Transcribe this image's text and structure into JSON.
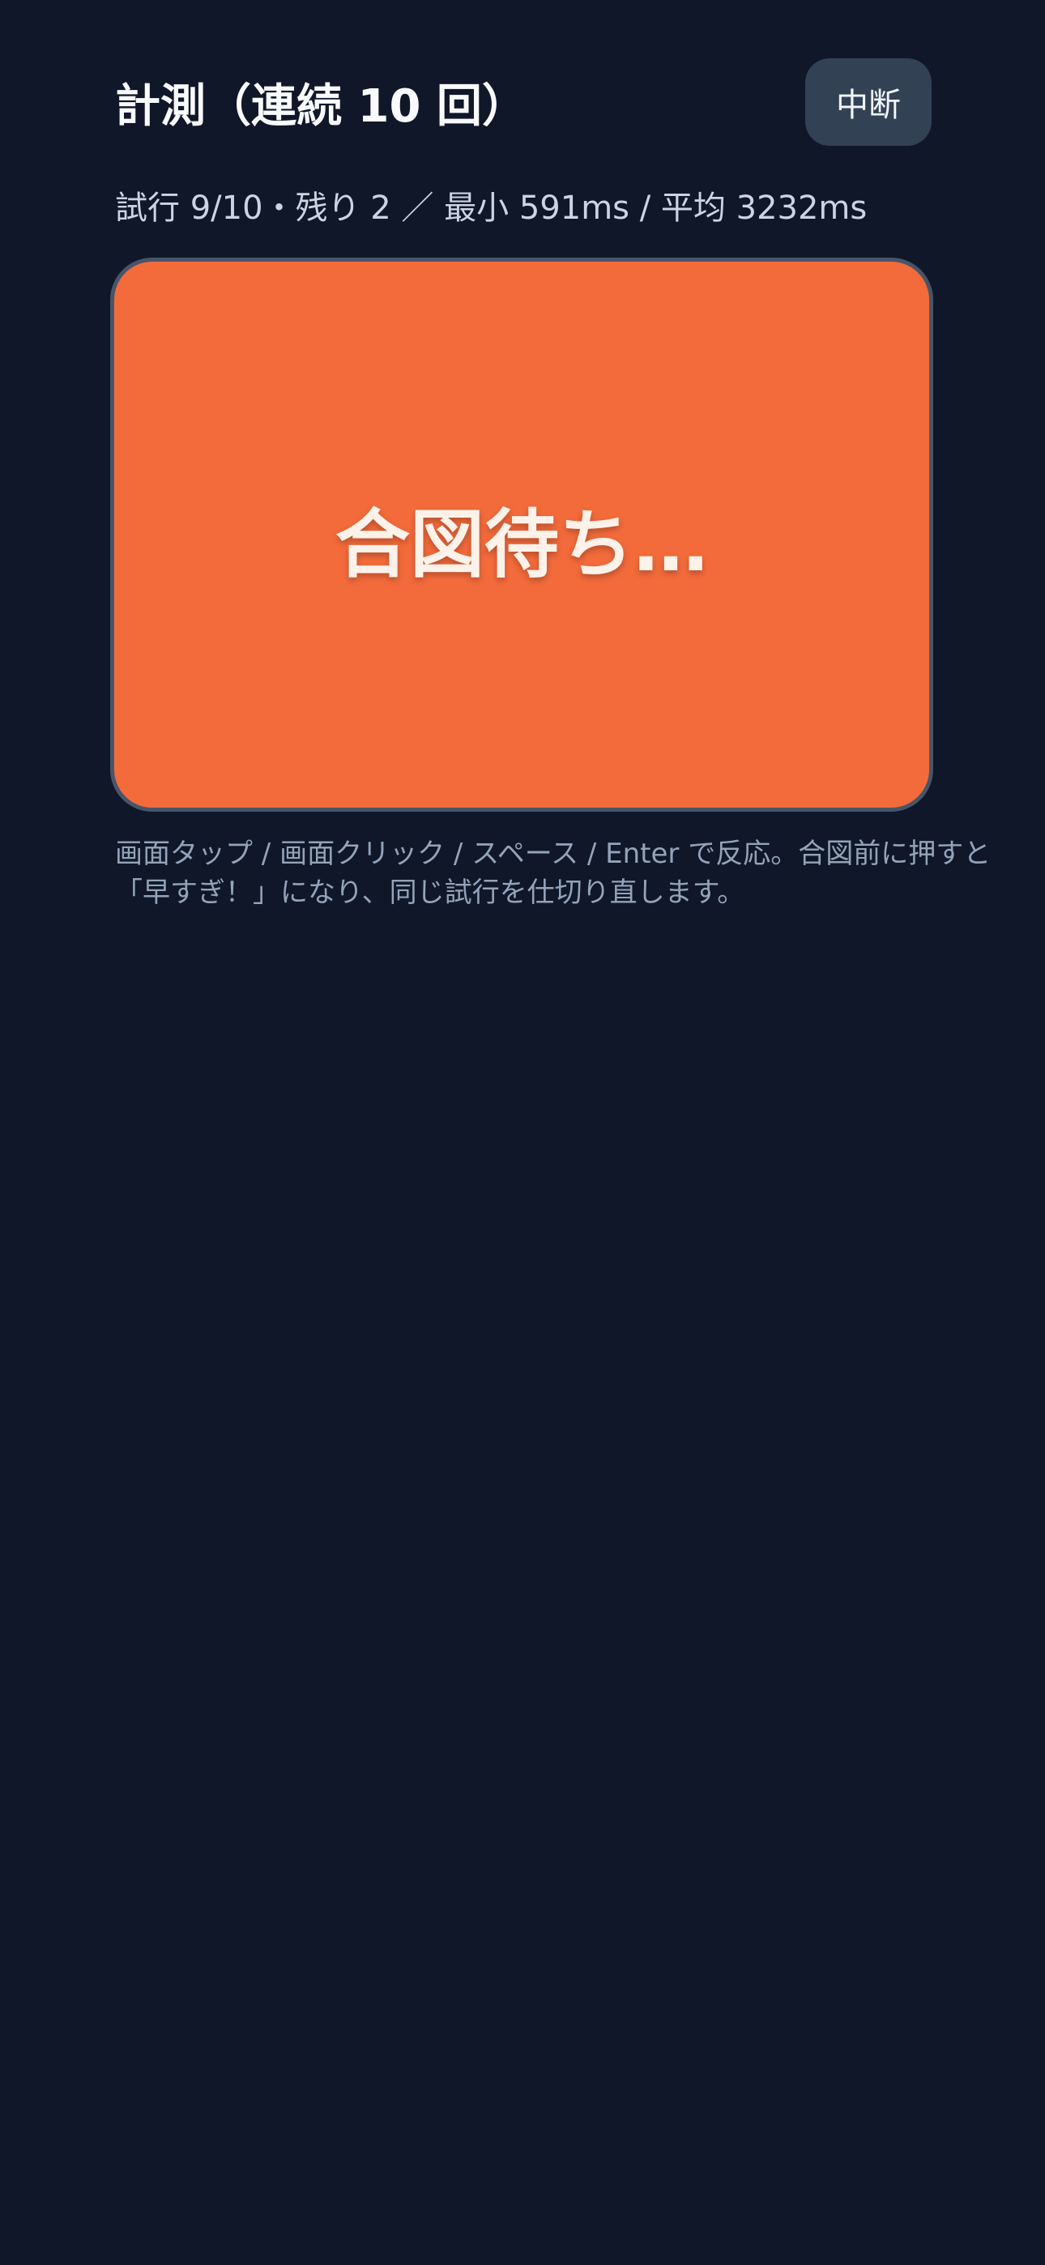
{
  "header": {
    "title": "計測（連続 10 回）",
    "abort_label": "中断"
  },
  "stats": {
    "text": "試行 9/10・残り 2 ／ 最小 591ms / 平均 3232ms"
  },
  "panel": {
    "status_text": "合図待ち…",
    "color": "#f46b3b"
  },
  "hint": {
    "line1": "画面タップ / 画面クリック / スペース / Enter で反応。合図前に押すと",
    "line2": "「早すぎ！」になり、同じ試行を仕切り直します。"
  }
}
